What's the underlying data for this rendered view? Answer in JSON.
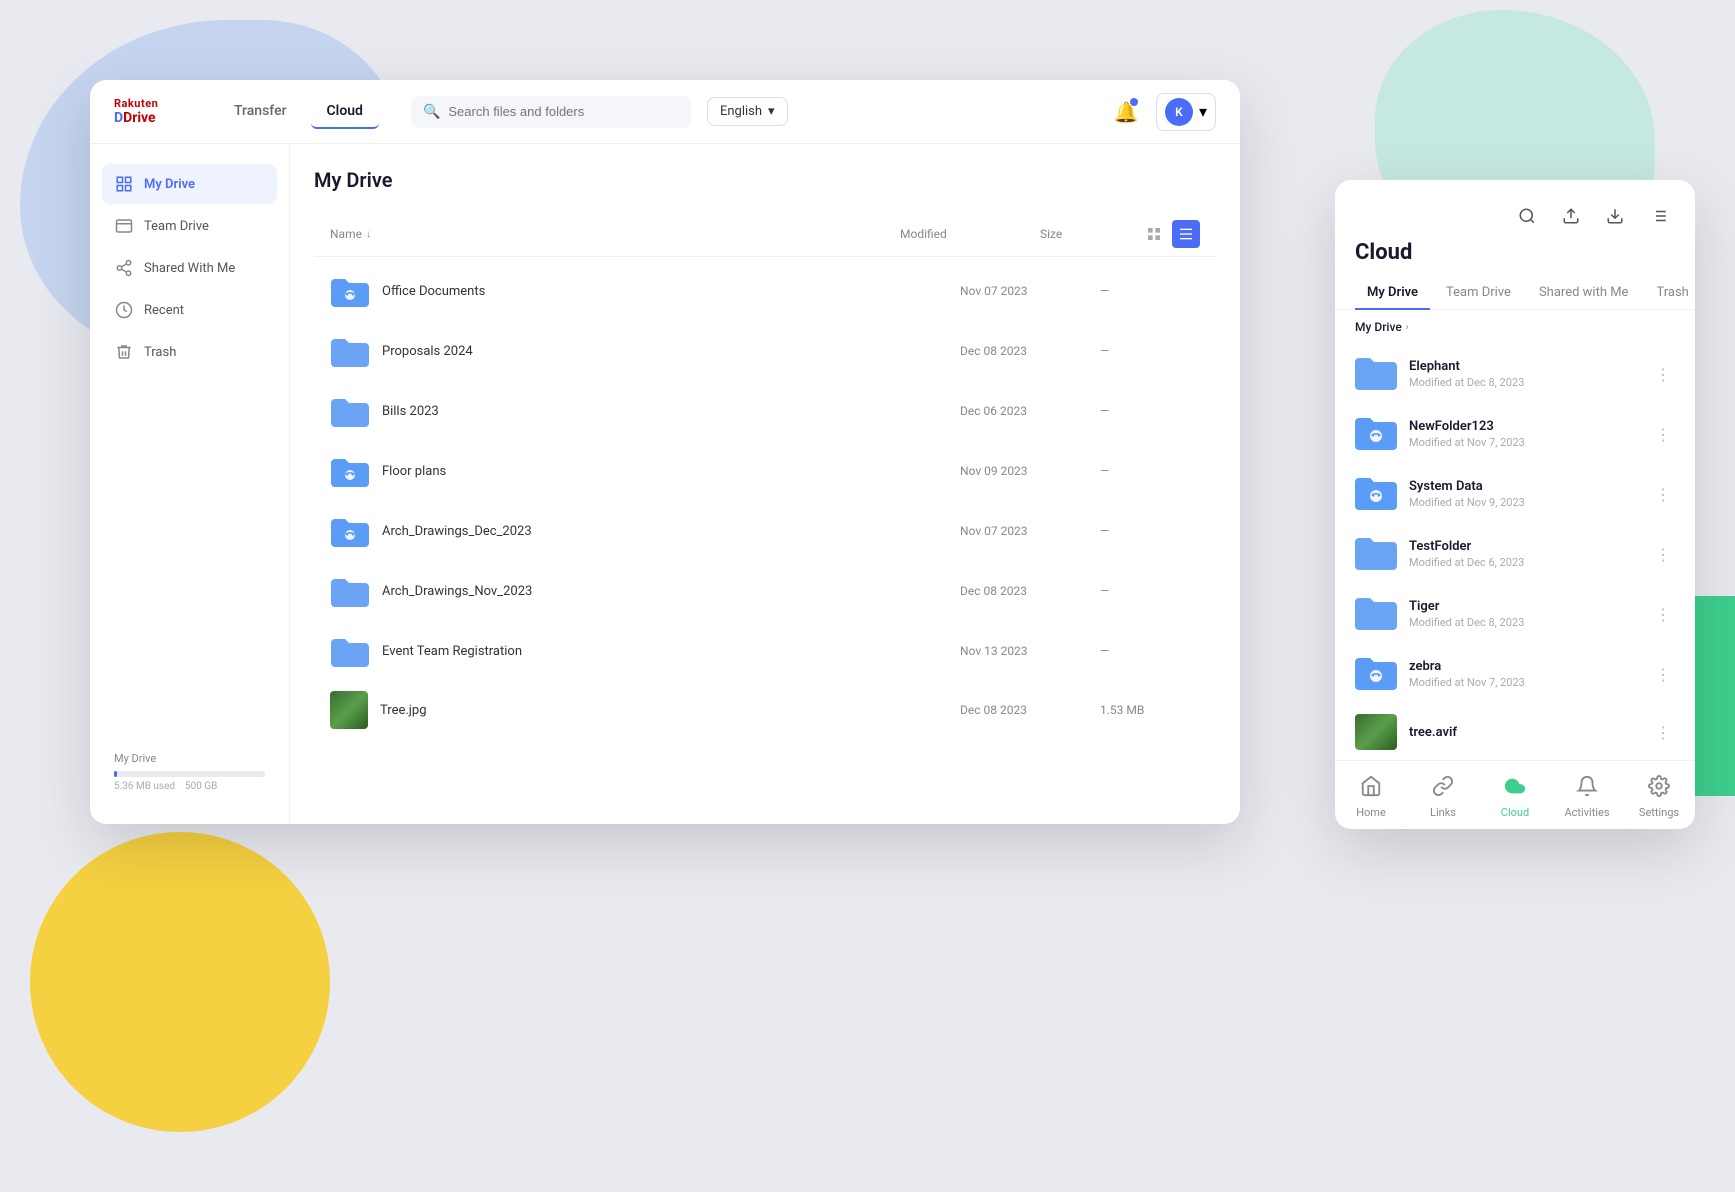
{
  "background": {
    "blob_blue": "light blue blob top left",
    "blob_teal": "teal blob top right",
    "blob_yellow": "yellow blob bottom left",
    "blob_green": "green blob right edge"
  },
  "header": {
    "logo_top": "Rakuten",
    "logo_bottom": "Drive",
    "nav": [
      {
        "label": "Transfer",
        "active": false
      },
      {
        "label": "Cloud",
        "active": true
      }
    ],
    "search_placeholder": "Search files and folders",
    "language": "English",
    "notification_label": "notifications",
    "user_initial": "K"
  },
  "sidebar": {
    "items": [
      {
        "id": "my-drive",
        "label": "My Drive",
        "icon": "🗂",
        "active": true
      },
      {
        "id": "team-drive",
        "label": "Team Drive",
        "icon": "📋",
        "active": false
      },
      {
        "id": "shared-with-me",
        "label": "Shared With Me",
        "icon": "🔗",
        "active": false
      },
      {
        "id": "recent",
        "label": "Recent",
        "icon": "🕐",
        "active": false
      },
      {
        "id": "trash",
        "label": "Trash",
        "icon": "🗑",
        "active": false
      }
    ],
    "storage": {
      "label": "My Drive",
      "used": "5.36 MB used",
      "total": "500 GB",
      "percent": 2
    }
  },
  "main": {
    "title": "My Drive",
    "columns": {
      "name": "Name",
      "modified": "Modified",
      "size": "Size"
    },
    "files": [
      {
        "name": "Office Documents",
        "modified": "Nov 07 2023",
        "size": "—",
        "type": "folder-shared"
      },
      {
        "name": "Proposals 2024",
        "modified": "Dec 08 2023",
        "size": "—",
        "type": "folder"
      },
      {
        "name": "Bills 2023",
        "modified": "Dec 06 2023",
        "size": "—",
        "type": "folder"
      },
      {
        "name": "Floor plans",
        "modified": "Nov 09 2023",
        "size": "—",
        "type": "folder-shared"
      },
      {
        "name": "Arch_Drawings_Dec_2023",
        "modified": "Nov 07 2023",
        "size": "—",
        "type": "folder-shared"
      },
      {
        "name": "Arch_Drawings_Nov_2023",
        "modified": "Dec 08 2023",
        "size": "—",
        "type": "folder"
      },
      {
        "name": "Event Team Registration",
        "modified": "Nov 13 2023",
        "size": "—",
        "type": "folder"
      },
      {
        "name": "Tree.jpg",
        "modified": "Dec 08 2023",
        "size": "1.53 MB",
        "type": "image"
      }
    ]
  },
  "right_panel": {
    "title": "Cloud",
    "tabs": [
      {
        "label": "My Drive",
        "active": true
      },
      {
        "label": "Team Drive",
        "active": false
      },
      {
        "label": "Shared with Me",
        "active": false
      },
      {
        "label": "Trash",
        "active": false
      }
    ],
    "breadcrumb": "My Drive",
    "files": [
      {
        "name": "Elephant",
        "date": "Modified at Dec 8, 2023",
        "type": "folder"
      },
      {
        "name": "NewFolder123",
        "date": "Modified at Nov 7, 2023",
        "type": "folder-shared"
      },
      {
        "name": "System Data",
        "date": "Modified at Nov 9, 2023",
        "type": "folder-shared"
      },
      {
        "name": "TestFolder",
        "date": "Modified at Dec 6, 2023",
        "type": "folder"
      },
      {
        "name": "Tiger",
        "date": "Modified at Dec 8, 2023",
        "type": "folder"
      },
      {
        "name": "zebra",
        "date": "Modified at Nov 7, 2023",
        "type": "folder-shared"
      },
      {
        "name": "tree.avif",
        "date": "",
        "type": "image"
      }
    ],
    "bottom_nav": [
      {
        "id": "home",
        "label": "Home",
        "icon": "🏠",
        "active": false
      },
      {
        "id": "links",
        "label": "Links",
        "icon": "🔗",
        "active": false
      },
      {
        "id": "cloud",
        "label": "Cloud",
        "icon": "☁",
        "active": true
      },
      {
        "id": "activities",
        "label": "Activities",
        "icon": "🔔",
        "active": false
      },
      {
        "id": "settings",
        "label": "Settings",
        "icon": "⚙",
        "active": false
      }
    ]
  }
}
